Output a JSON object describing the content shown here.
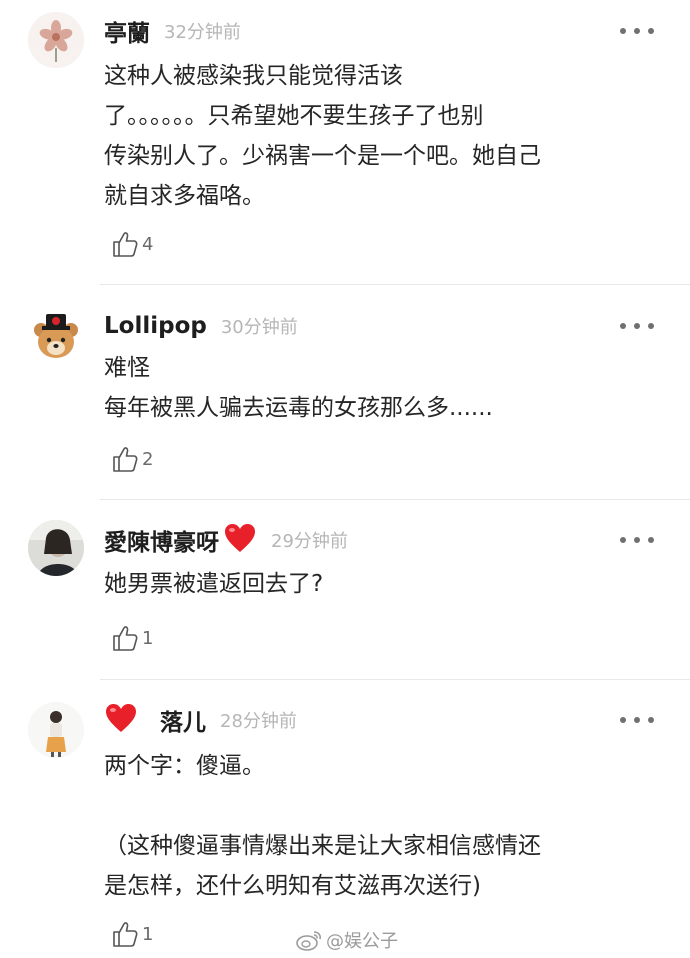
{
  "comments": [
    {
      "name": "亭蘭",
      "time": "32分钟前",
      "avatar": "flower-avatar",
      "lines": [
        "这种人被感染我只能觉得活该",
        "了。。。。。。只希望她不要生孩子了也别",
        "传染别人了。少祸害一个是一个吧。她自己",
        "就自求多福咯。"
      ],
      "likes": "4"
    },
    {
      "name": "Lollipop",
      "time": "30分钟前",
      "avatar": "bear-avatar",
      "lines": [
        "难怪",
        "每年被黑人骗去运毒的女孩那么多......"
      ],
      "likes": "2"
    },
    {
      "name": "愛陳博豪呀",
      "time": "29分钟前",
      "avatar": "photo-avatar",
      "lines": [
        "她男票被遣返回去了?"
      ],
      "likes": "1"
    },
    {
      "name": "落儿",
      "time": "28分钟前",
      "avatar": "figure-avatar",
      "lines": [
        "两个字：傻逼。",
        "",
        "（这种傻逼事情爆出来是让大家相信感情还",
        "是怎样，还什么明知有艾滋再次送行)"
      ],
      "likes": "1"
    }
  ],
  "watermark": "@娱公子",
  "colors": {
    "heart": "#e8202a",
    "name": "#1e1e1e",
    "time": "#b6b6b6",
    "body": "#262626"
  }
}
